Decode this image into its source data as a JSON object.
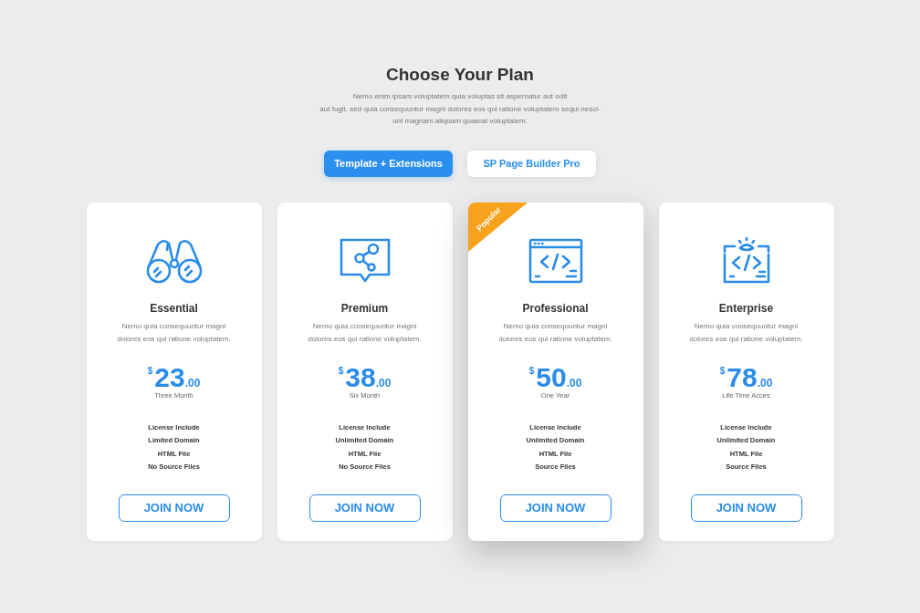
{
  "header": {
    "title": "Choose Your Plan",
    "description": [
      "Nemo enim ipsam voluptatem quia voluptas sit aspernatur aut odit",
      "aut fugit, sed quia consequuntur magni dolores eos qui ratione voluptatem sequi nesci-",
      "unt magnam aliquam quaerat voluptatem."
    ]
  },
  "tabs": [
    {
      "label": "Template + Extensions",
      "selected": true
    },
    {
      "label": "SP Page Builder Pro",
      "selected": false
    }
  ],
  "plans": [
    {
      "name": "Essential",
      "description": [
        "Nemo quia consequuntur magni",
        "dolores eos qui ratione voluptatem."
      ],
      "currency": "$",
      "amount": "23",
      "cents": ".00",
      "period": "Three Month",
      "features": [
        "License Include",
        "Limited Domain",
        "HTML File",
        "No Source Files"
      ],
      "button": "JOIN NOW",
      "highlighted": false
    },
    {
      "name": "Premium",
      "description": [
        "Nemo quia consequuntur magni",
        "dolores eos qui ratione voluptatem."
      ],
      "currency": "$",
      "amount": "38",
      "cents": ".00",
      "period": "Six Month",
      "features": [
        "License Include",
        "Unlimited Domain",
        "HTML File",
        "No Source Files"
      ],
      "button": "JOIN NOW",
      "highlighted": false
    },
    {
      "name": "Professional",
      "ribbon": "Popular",
      "description": [
        "Nemo quia consequuntur magni",
        "dolores eos qui ratione voluptatem."
      ],
      "currency": "$",
      "amount": "50",
      "cents": ".00",
      "period": "One Year",
      "features": [
        "License Include",
        "Unlimited Domain",
        "HTML File",
        "Source Files"
      ],
      "button": "JOIN NOW",
      "highlighted": true
    },
    {
      "name": "Enterprise",
      "description": [
        "Nemo quia consequuntur magni",
        "dolores eos qui ratione voluptatem."
      ],
      "currency": "$",
      "amount": "78",
      "cents": ".00",
      "period": "Life Time Acces",
      "features": [
        "License Include",
        "Unlimited Domain",
        "HTML File",
        "Source Files"
      ],
      "button": "JOIN NOW",
      "highlighted": false
    }
  ]
}
